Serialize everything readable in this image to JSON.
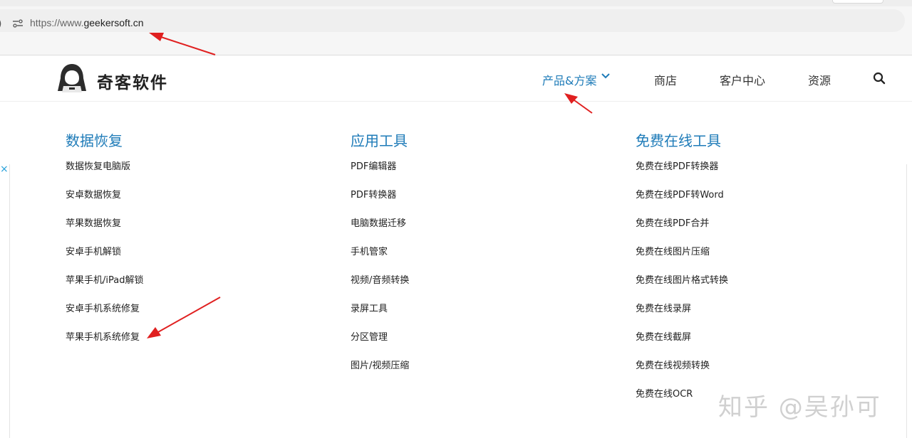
{
  "browser": {
    "url_prefix": "https://www.",
    "url_host": "geekersoft.cn",
    "left_glyph": ")"
  },
  "site": {
    "brand": "奇客软件",
    "nav": [
      {
        "label": "产品&方案",
        "active": true
      },
      {
        "label": "商店"
      },
      {
        "label": "客户中心"
      },
      {
        "label": "资源"
      }
    ],
    "accent_color": "#1e7bb8"
  },
  "menu": {
    "columns": [
      {
        "title": "数据恢复",
        "items": [
          "数据恢复电脑版",
          "安卓数据恢复",
          "苹果数据恢复",
          "安卓手机解锁",
          "苹果手机/iPad解锁",
          "安卓手机系统修复",
          "苹果手机系统修复"
        ]
      },
      {
        "title": "应用工具",
        "items": [
          "PDF编辑器",
          "PDF转换器",
          "电脑数据迁移",
          "手机管家",
          "视频/音频转换",
          "录屏工具",
          "分区管理",
          "图片/视频压缩"
        ]
      },
      {
        "title": "免费在线工具",
        "items": [
          "免费在线PDF转换器",
          "免费在线PDF转Word",
          "免费在线PDF合并",
          "免费在线图片压缩",
          "免费在线图片格式转换",
          "免费在线录屏",
          "免费在线截屏",
          "免费在线视频转换",
          "免费在线OCR"
        ]
      }
    ]
  },
  "side_marker": "×",
  "watermark": "知乎 @吴孙可",
  "annotation_color": "#e02020"
}
